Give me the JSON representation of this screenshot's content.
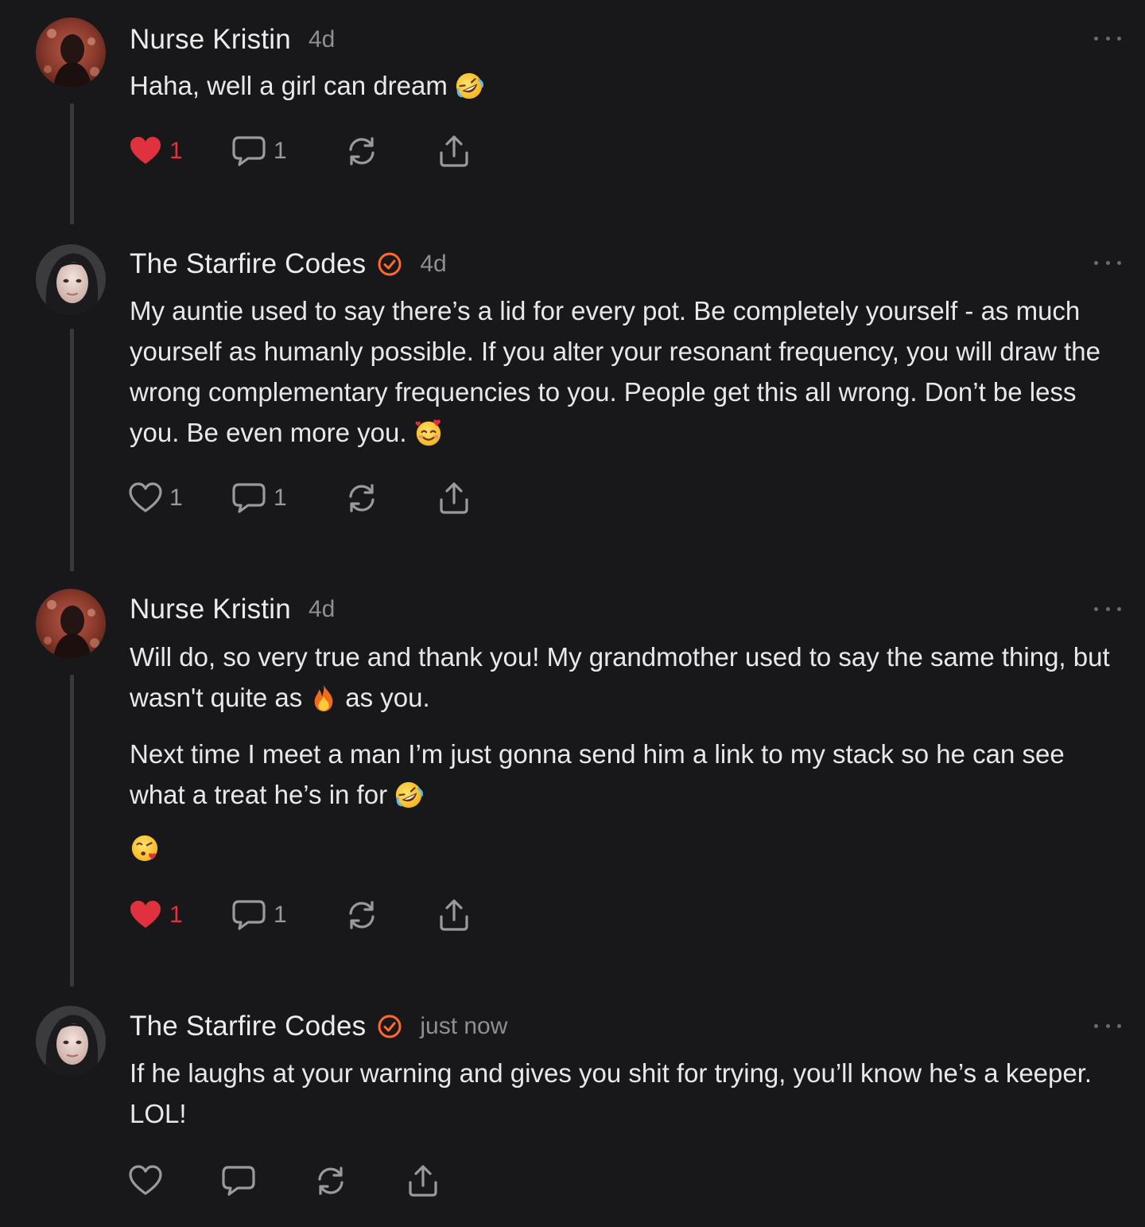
{
  "comments": [
    {
      "author": "Nurse Kristin",
      "time": "4d",
      "verified": false,
      "avatar": "nurse-kristin-avatar",
      "paragraphs": [
        "Haha, well a girl can dream"
      ],
      "likes": "1",
      "liked": true,
      "replies": "1"
    },
    {
      "author": "The Starfire Codes",
      "time": "4d",
      "verified": true,
      "avatar": "starfire-codes-avatar",
      "paragraphs": [
        "My auntie used to say there’s a lid for every pot. Be completely yourself - as much yourself as humanly possible. If you alter your resonant frequency, you will draw the wrong complementary frequencies to you. People get this all wrong. Don’t be less you. Be even more you."
      ],
      "likes": "1",
      "liked": false,
      "replies": "1"
    },
    {
      "author": "Nurse Kristin",
      "time": "4d",
      "verified": false,
      "avatar": "nurse-kristin-avatar",
      "paragraphs": [
        "Will do, so very true and thank you!  My grandmother used to say the same thing, but wasn't quite as",
        "as you.",
        "Next time I meet a man I’m just gonna send him a link to my stack so he can see what a treat he’s in for"
      ],
      "likes": "1",
      "liked": true,
      "replies": "1"
    },
    {
      "author": "The Starfire Codes",
      "time": "just now",
      "verified": true,
      "avatar": "starfire-codes-avatar",
      "paragraphs": [
        "If he laughs at your warning and gives you shit for trying, you’ll know he’s a keeper. LOL!"
      ],
      "likes": "",
      "liked": false,
      "replies": ""
    }
  ],
  "icons": {
    "heart": "heart-icon",
    "comment": "comment-icon",
    "restack": "restack-icon",
    "share": "share-icon",
    "more": "more-options-icon",
    "verified": "verified-check-icon"
  },
  "colors": {
    "background": "#18181a",
    "liked": "#e0323e",
    "verified": "#ff6a2b",
    "muted": "#8f8f93"
  }
}
